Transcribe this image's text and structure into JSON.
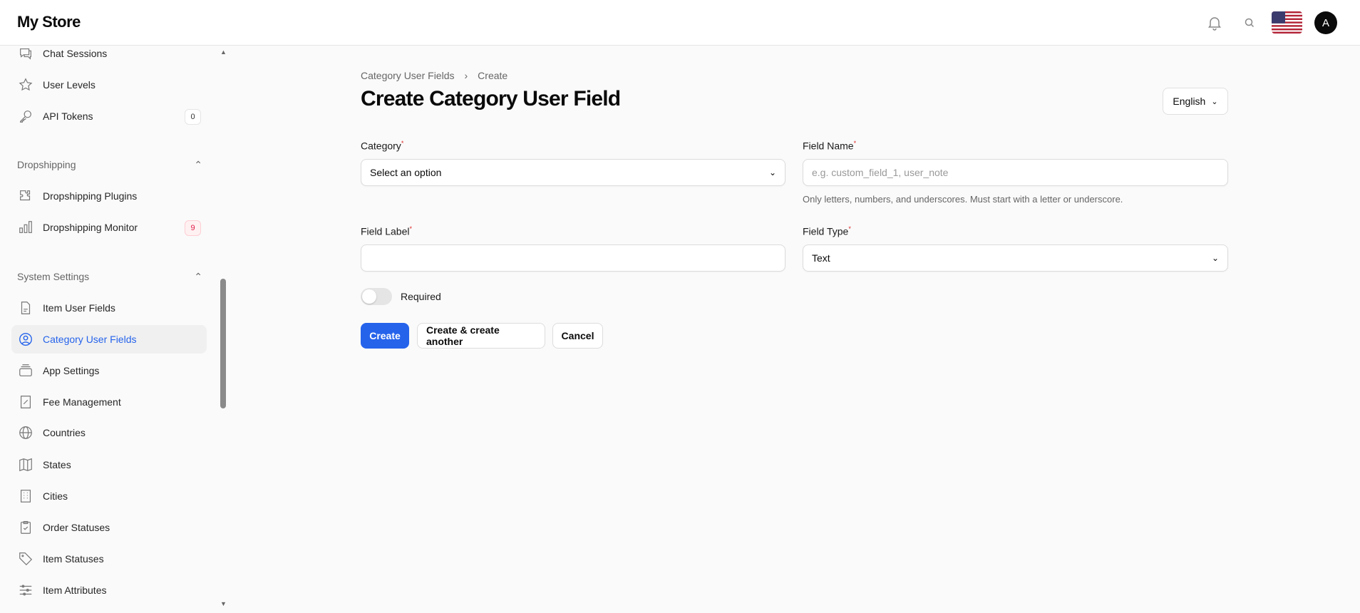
{
  "header": {
    "title": "My Store",
    "avatar_initial": "A"
  },
  "sidebar": {
    "items": [
      {
        "label": "Chat Sessions",
        "icon": "chat-icon"
      },
      {
        "label": "User Levels",
        "icon": "star-icon"
      },
      {
        "label": "API Tokens",
        "icon": "key-icon",
        "badge": "0"
      }
    ],
    "groups": [
      {
        "label": "Dropshipping",
        "items": [
          {
            "label": "Dropshipping Plugins",
            "icon": "puzzle-icon"
          },
          {
            "label": "Dropshipping Monitor",
            "icon": "bar-chart-icon",
            "badge": "9"
          }
        ]
      },
      {
        "label": "System Settings",
        "items": [
          {
            "label": "Item User Fields"
          },
          {
            "label": "Category User Fields"
          },
          {
            "label": "App Settings"
          },
          {
            "label": "Fee Management"
          },
          {
            "label": "Countries"
          },
          {
            "label": "States"
          },
          {
            "label": "Cities"
          },
          {
            "label": "Order Statuses"
          },
          {
            "label": "Item Statuses"
          },
          {
            "label": "Item Attributes"
          }
        ]
      }
    ]
  },
  "breadcrumb": [
    "Category User Fields",
    "Create"
  ],
  "page_title": "Create Category User Field",
  "language": "English",
  "form": {
    "category": {
      "label": "Category",
      "value": "Select an option"
    },
    "field_name": {
      "label": "Field Name",
      "placeholder": "e.g. custom_field_1, user_note",
      "help": "Only letters, numbers, and underscores. Must start with a letter or underscore."
    },
    "field_label": {
      "label": "Field Label",
      "value": ""
    },
    "field_type": {
      "label": "Field Type",
      "value": "Text"
    },
    "required": {
      "label": "Required",
      "on": false
    }
  },
  "buttons": {
    "create": "Create",
    "create_another": "Create & create another",
    "cancel": "Cancel"
  },
  "colors": {
    "accent": "#2563eb",
    "required": "#dc2626"
  }
}
